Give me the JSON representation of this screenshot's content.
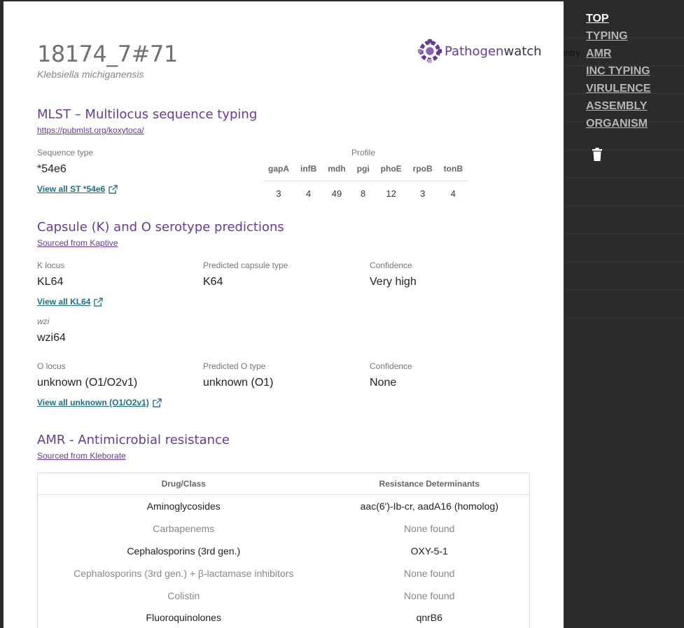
{
  "genome": {
    "name": "18174_7#71",
    "organism": "Klebsiella michiganensis"
  },
  "logo": {
    "brand_a": "Pathogen",
    "brand_b": "watch"
  },
  "background": {
    "partial_text": "untry"
  },
  "mlst": {
    "heading": "MLST – Multilocus sequence typing",
    "source": "https://pubmlst.org/koxytoca/",
    "st_label": "Sequence type",
    "st_value": "*54e6",
    "view_link": "View all ST *54e6",
    "profile_label": "Profile",
    "genes": [
      "gapA",
      "infB",
      "mdh",
      "pgi",
      "phoE",
      "rpoB",
      "tonB"
    ],
    "alleles": [
      "3",
      "4",
      "49",
      "8",
      "12",
      "3",
      "4"
    ]
  },
  "kaptive": {
    "heading": "Capsule (K) and O serotype predictions",
    "source": "Sourced from Kaptive",
    "k_locus_label": "K locus",
    "k_locus_value": "KL64",
    "pred_capsule_label": "Predicted capsule type",
    "pred_capsule_value": "K64",
    "k_conf_label": "Confidence",
    "k_conf_value": "Very high",
    "k_view_link": "View all KL64",
    "wzi_label": "wzi",
    "wzi_value": "wzi64",
    "o_locus_label": "O locus",
    "o_locus_value": "unknown (O1/O2v1)",
    "pred_o_label": "Predicted O type",
    "pred_o_value": "unknown (O1)",
    "o_conf_label": "Confidence",
    "o_conf_value": "None",
    "o_view_link": "View all unknown (O1/O2v1)"
  },
  "amr": {
    "heading": "AMR - Antimicrobial resistance",
    "source": "Sourced from Kleborate",
    "col_drug": "Drug/Class",
    "col_det": "Resistance Determinants",
    "rows": [
      {
        "drug": "Aminoglycosides",
        "det": "aac(6')-Ib-cr, aadA16 (homolog)",
        "found": true
      },
      {
        "drug": "Carbapenems",
        "det": "None found",
        "found": false
      },
      {
        "drug": "Cephalosporins (3rd gen.)",
        "det": "OXY-5-1",
        "found": true
      },
      {
        "drug": "Cephalosporins (3rd gen.) + β-lactamase inhibitors",
        "det": "None found",
        "found": false
      },
      {
        "drug": "Colistin",
        "det": "None found",
        "found": false
      },
      {
        "drug": "Fluoroquinolones",
        "det": "qnrB6",
        "found": true
      }
    ]
  },
  "nav": {
    "items": [
      "TOP",
      "TYPING",
      "AMR",
      "INC TYPING",
      "VIRULENCE",
      "ASSEMBLY",
      "ORGANISM"
    ],
    "active": "TOP",
    "trash_icon": "trash-icon"
  },
  "colors": {
    "accent": "#673c90",
    "link": "#1f6f82",
    "overlay": "#2b2b2b"
  }
}
